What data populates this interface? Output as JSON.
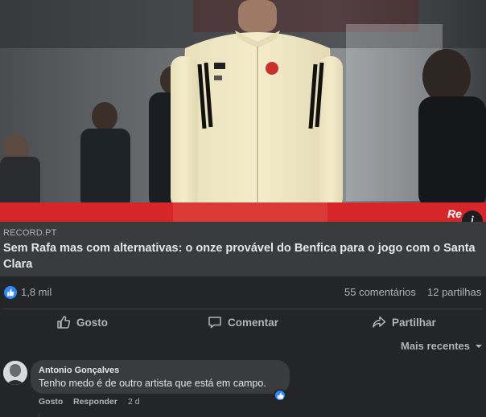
{
  "post": {
    "image": {
      "description_icon": "info-icon",
      "info_label": "i",
      "watermark": "Re"
    },
    "link": {
      "domain": "RECORD.PT",
      "headline": "Sem Rafa mas com alternativas: o onze provável do Benfica para o jogo com o Santa Clara"
    },
    "stats": {
      "reactions": "1,8 mil",
      "comments": "55 comentários",
      "shares": "12 partilhas"
    },
    "actions": {
      "like": "Gosto",
      "comment": "Comentar",
      "share": "Partilhar"
    },
    "sort_label": "Mais recentes"
  },
  "comments": [
    {
      "author": "Antonio Gonçalves",
      "text": "Tenho medo é de outro artista que está em campo.",
      "like_label": "Gosto",
      "reply_label": "Responder",
      "time": "2 d"
    }
  ],
  "colors": {
    "accent_blue": "#2d88ff",
    "banner_red": "#d6262a",
    "background": "#242526",
    "surface": "#3a3b3c"
  }
}
